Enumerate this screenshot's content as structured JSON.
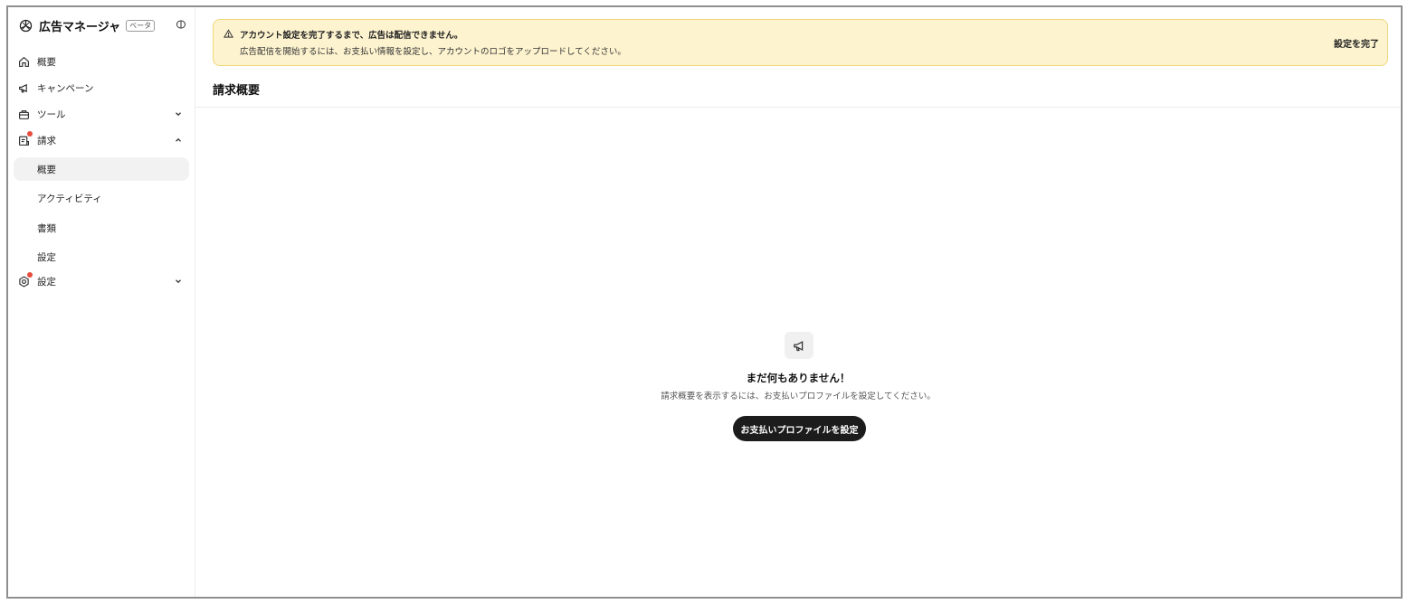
{
  "brand": {
    "title": "広告マネージャ",
    "badge": "ベータ",
    "logo_icon": "openai-logo-icon",
    "collapse_icon": "sidebar-toggle-icon"
  },
  "sidebar": {
    "items": [
      {
        "label": "概要",
        "icon": "home-icon"
      },
      {
        "label": "キャンペーン",
        "icon": "megaphone-icon"
      },
      {
        "label": "ツール",
        "icon": "toolbox-icon",
        "chevron": "down"
      },
      {
        "label": "請求",
        "icon": "invoice-icon",
        "chevron": "up",
        "notification": true
      },
      {
        "label": "設定",
        "icon": "gear-icon",
        "chevron": "down",
        "notification": true
      }
    ],
    "billing_subitems": [
      {
        "label": "概要",
        "active": true
      },
      {
        "label": "アクティビティ"
      },
      {
        "label": "書類"
      },
      {
        "label": "設定"
      }
    ]
  },
  "banner": {
    "icon": "warning-icon",
    "title": "アカウント設定を完了するまで、広告は配信できません。",
    "description": "広告配信を開始するには、お支払い情報を設定し、アカウントのロゴをアップロードしてください。",
    "action_label": "設定を完了"
  },
  "page": {
    "title": "請求概要"
  },
  "empty_state": {
    "icon": "megaphone-icon",
    "title": "まだ何もありません！",
    "description": "請求概要を表示するには、お支払いプロファイルを設定してください。",
    "button_label": "お支払いプロファイルを設定"
  },
  "colors": {
    "banner_bg": "#fdf3cf",
    "banner_border": "#f0d77a",
    "notification_dot": "#e74c3c",
    "primary_button": "#1c1c1c"
  }
}
